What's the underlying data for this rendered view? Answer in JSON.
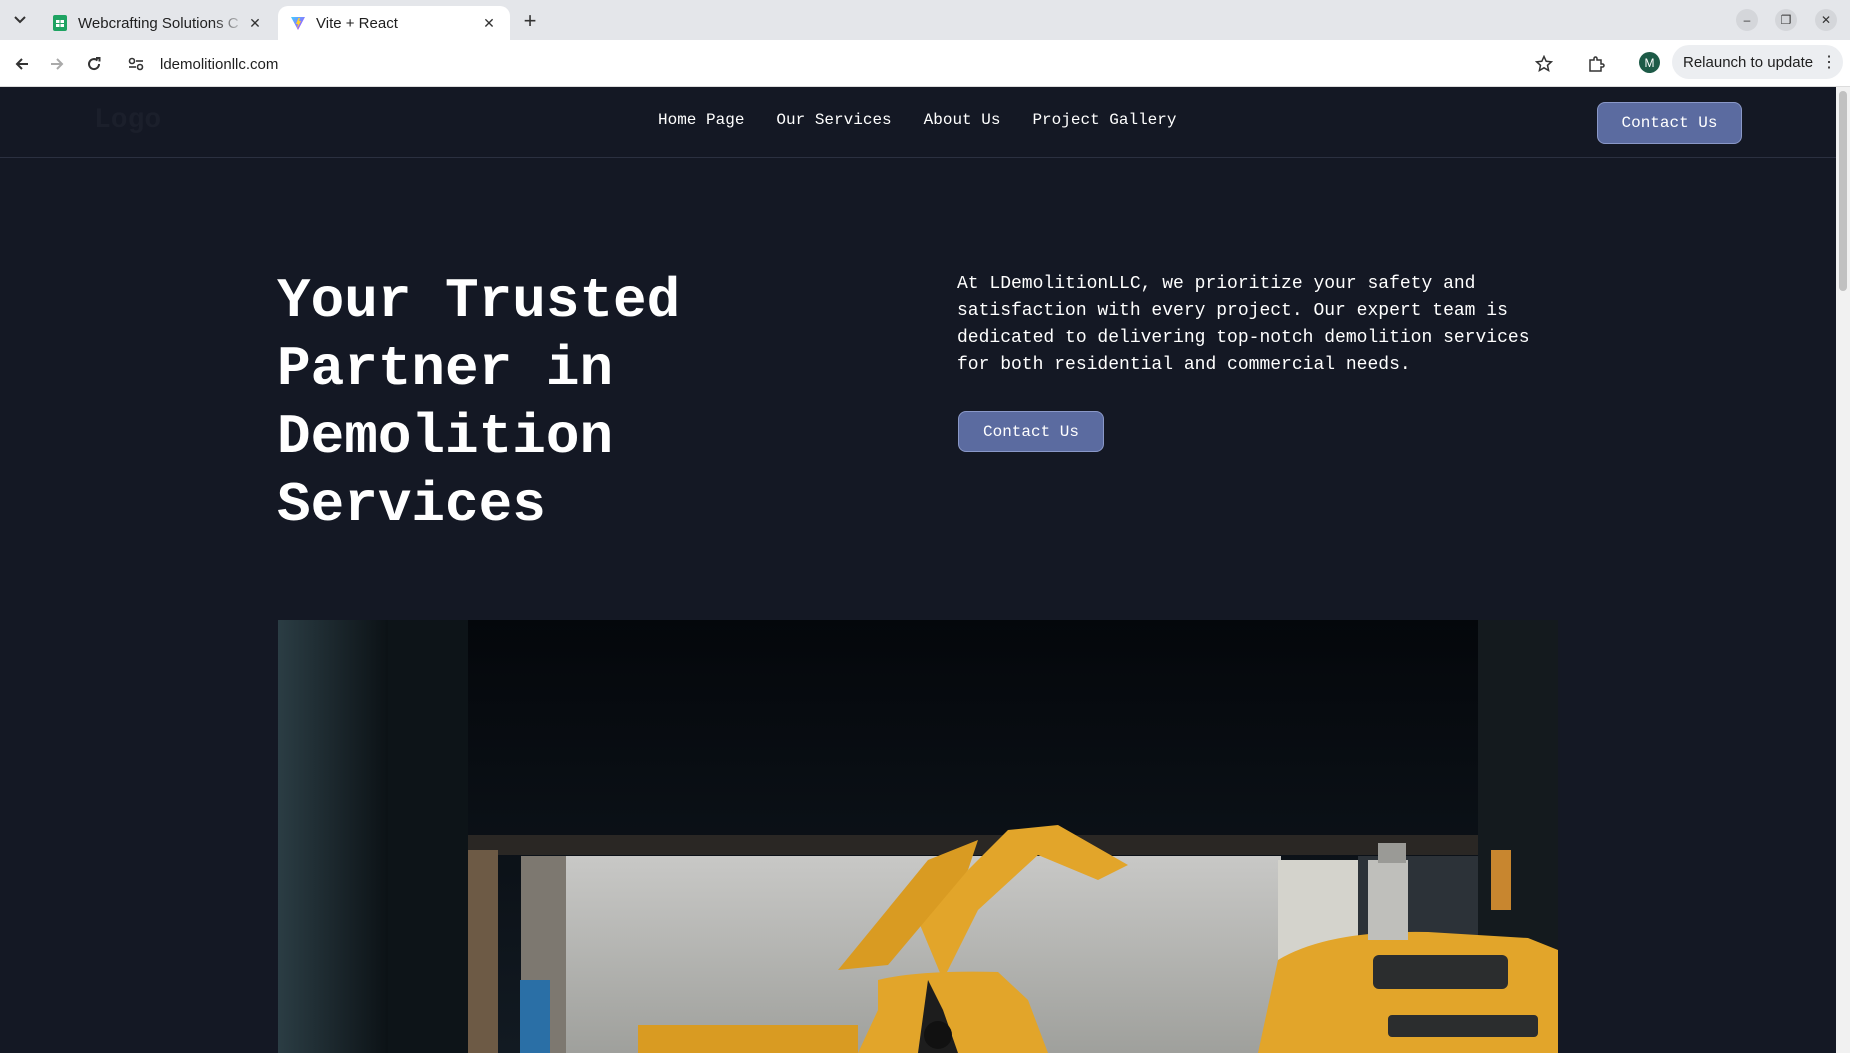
{
  "browser": {
    "tabs": [
      {
        "title": "Webcrafting Solutions C",
        "favicon": "sheets-icon",
        "active": false
      },
      {
        "title": "Vite + React",
        "favicon": "vite-icon",
        "active": true
      }
    ],
    "url": "ldemolitionllc.com",
    "profile_initial": "M",
    "relaunch_label": "Relaunch to update"
  },
  "navbar": {
    "logo": "Logo",
    "links": [
      "Home Page",
      "Our Services",
      "About Us",
      "Project Gallery"
    ],
    "cta_label": "Contact Us"
  },
  "hero": {
    "title": "Your Trusted Partner in Demolition Services",
    "description": "At LDemolitionLLC, we prioritize your safety and satisfaction with every project. Our expert team is dedicated to delivering top-notch demolition services for both residential and commercial needs.",
    "cta_label": "Contact Us"
  },
  "colors": {
    "page_background": "#141824",
    "button_background": "#5b6ba0",
    "excavator_yellow": "#e2a52a"
  }
}
